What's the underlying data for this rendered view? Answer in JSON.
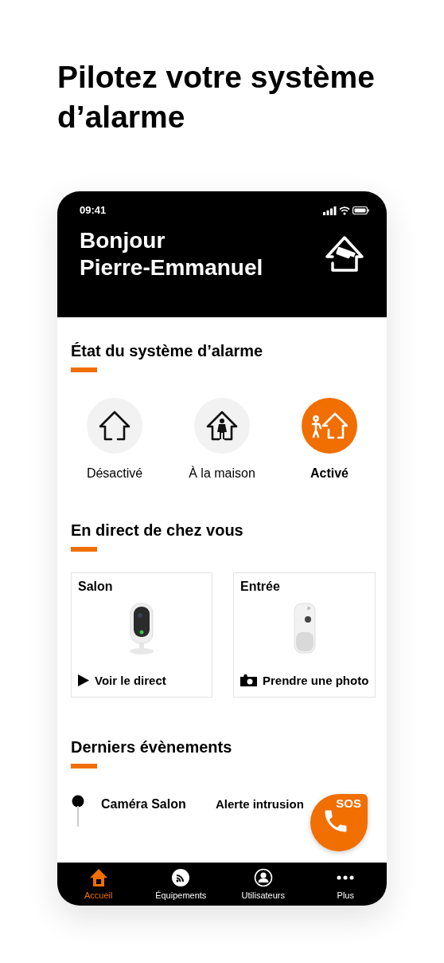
{
  "page_title": "Pilotez votre système d’alarme",
  "status_bar": {
    "time": "09:41"
  },
  "header": {
    "greeting": "Bonjour",
    "name": "Pierre-Emmanuel"
  },
  "alarm_section": {
    "title": "État du système d’alarme",
    "modes": [
      {
        "label": "Désactivé",
        "kind": "off",
        "selected": false
      },
      {
        "label": "À la maison",
        "kind": "home",
        "selected": false
      },
      {
        "label": "Activé",
        "kind": "armed",
        "selected": true
      }
    ]
  },
  "live_section": {
    "title": "En direct de chez vous",
    "cameras": [
      {
        "name": "Salon",
        "kind": "camera",
        "action": "Voir le direct"
      },
      {
        "name": "Entrée",
        "kind": "detector",
        "action": "Prendre une photo"
      }
    ]
  },
  "events_section": {
    "title": "Derniers évènements",
    "events": [
      {
        "source": "Caméra Salon",
        "label": "Alerte intrusion"
      }
    ]
  },
  "sos_button": {
    "label": "SOS"
  },
  "tab_bar": [
    {
      "label": "Accueil",
      "kind": "home",
      "selected": true
    },
    {
      "label": "Équipements",
      "kind": "devices",
      "selected": false
    },
    {
      "label": "Utilisateurs",
      "kind": "users",
      "selected": false
    },
    {
      "label": "Plus",
      "kind": "more",
      "selected": false
    }
  ]
}
